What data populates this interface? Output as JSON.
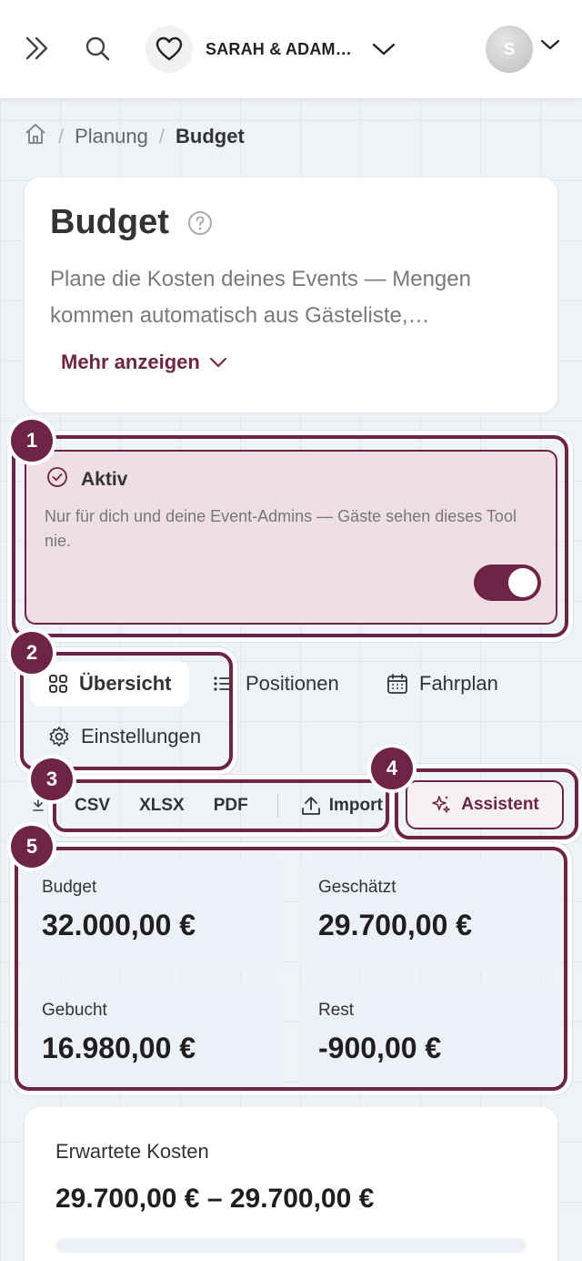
{
  "topbar": {
    "event_name": "SARAH & ADAM…",
    "avatar_initial": "S"
  },
  "breadcrumb": {
    "items": [
      "Planung",
      "Budget"
    ]
  },
  "intro": {
    "title": "Budget",
    "description": "Plane die Kosten deines Events — Mengen kommen automatisch aus Gästeliste,…",
    "more_label": "Mehr anzeigen"
  },
  "status": {
    "title": "Aktiv",
    "description": "Nur für dich und deine Event-Admins — Gäste sehen dieses Tool nie.",
    "toggle_on": true
  },
  "tabs": [
    {
      "label": "Übersicht",
      "icon": "grid-icon",
      "active": true
    },
    {
      "label": "Positionen",
      "icon": "list-icon",
      "active": false
    },
    {
      "label": "Fahrplan",
      "icon": "calendar-icon",
      "active": false
    },
    {
      "label": "Einstellungen",
      "icon": "gear-icon",
      "active": false
    }
  ],
  "exports": {
    "csv": "CSV",
    "xlsx": "XLSX",
    "pdf": "PDF",
    "import": "Import"
  },
  "assistant_label": "Assistent",
  "stats": [
    {
      "label": "Budget",
      "value": "32.000,00 €"
    },
    {
      "label": "Geschätzt",
      "value": "29.700,00 €"
    },
    {
      "label": "Gebucht",
      "value": "16.980,00 €"
    },
    {
      "label": "Rest",
      "value": "-900,00 €"
    }
  ],
  "expected": {
    "label": "Erwartete Kosten",
    "value": "29.700,00 € – 29.700,00 €"
  },
  "markers": [
    "1",
    "2",
    "3",
    "4",
    "5"
  ],
  "colors": {
    "accent": "#6e2445",
    "status_bg": "#eddfe3",
    "stat_bg": "#edf1f7"
  }
}
